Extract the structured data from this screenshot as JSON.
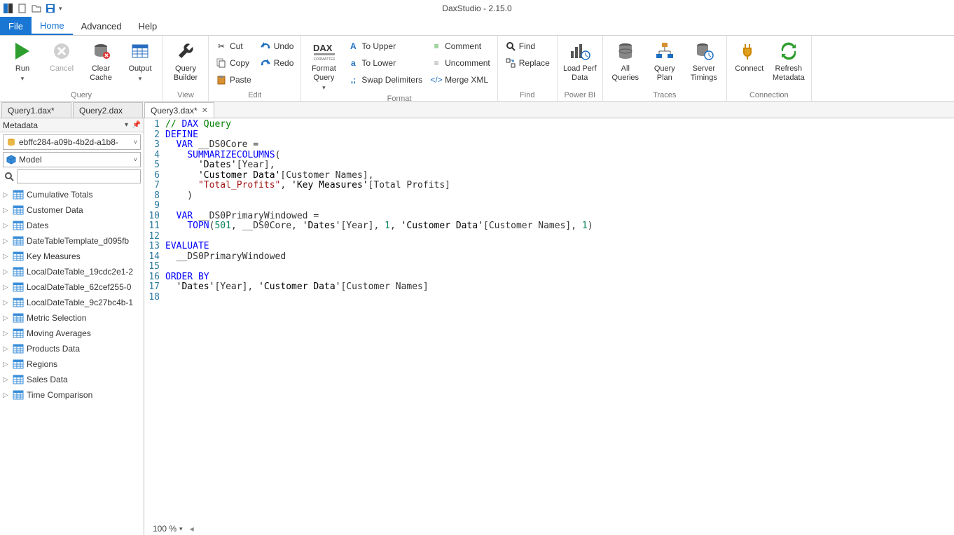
{
  "title": "DaxStudio - 2.15.0",
  "menu": {
    "file": "File",
    "home": "Home",
    "advanced": "Advanced",
    "help": "Help"
  },
  "ribbon": {
    "query": {
      "label": "Query",
      "run": "Run",
      "cancel": "Cancel",
      "clear_cache": "Clear\nCache",
      "output": "Output"
    },
    "view": {
      "label": "View",
      "query_builder": "Query\nBuilder"
    },
    "edit": {
      "label": "Edit",
      "cut": "Cut",
      "copy": "Copy",
      "paste": "Paste",
      "undo": "Undo",
      "redo": "Redo"
    },
    "format": {
      "label": "Format",
      "format_query": "Format\nQuery",
      "to_upper": "To Upper",
      "to_lower": "To Lower",
      "swap_delim": "Swap Delimiters",
      "comment": "Comment",
      "uncomment": "Uncomment",
      "merge_xml": "Merge XML"
    },
    "find": {
      "label": "Find",
      "find": "Find",
      "replace": "Replace"
    },
    "powerbi": {
      "label": "Power BI",
      "load_perf": "Load Perf\nData"
    },
    "traces": {
      "label": "Traces",
      "all_queries": "All\nQueries",
      "query_plan": "Query\nPlan",
      "server_timings": "Server\nTimings"
    },
    "connection": {
      "label": "Connection",
      "connect": "Connect",
      "refresh_metadata": "Refresh\nMetadata"
    }
  },
  "tabs": [
    {
      "label": "Query1.dax*",
      "active": false
    },
    {
      "label": "Query2.dax",
      "active": false
    },
    {
      "label": "Query3.dax*",
      "active": true
    }
  ],
  "metadata": {
    "panel_label": "Metadata",
    "database": "ebffc284-a09b-4b2d-a1b8-",
    "model": "Model",
    "tables": [
      "Cumulative Totals",
      "Customer Data",
      "Dates",
      "DateTableTemplate_d095fb",
      "Key Measures",
      "LocalDateTable_19cdc2e1-2",
      "LocalDateTable_62cef255-0",
      "LocalDateTable_9c27bc4b-1",
      "Metric Selection",
      "Moving Averages",
      "Products Data",
      "Regions",
      "Sales Data",
      "Time Comparison"
    ]
  },
  "editor": {
    "zoom": "100 %",
    "lines": [
      "// DAX Query",
      "DEFINE",
      "  VAR __DS0Core =",
      "    SUMMARIZECOLUMNS(",
      "      'Dates'[Year],",
      "      'Customer Data'[Customer Names],",
      "      \"Total_Profits\", 'Key Measures'[Total Profits]",
      "    )",
      "",
      "  VAR __DS0PrimaryWindowed =",
      "    TOPN(501, __DS0Core, 'Dates'[Year], 1, 'Customer Data'[Customer Names], 1)",
      "",
      "EVALUATE",
      "  __DS0PrimaryWindowed",
      "",
      "ORDER BY",
      "  'Dates'[Year], 'Customer Data'[Customer Names]",
      ""
    ]
  }
}
